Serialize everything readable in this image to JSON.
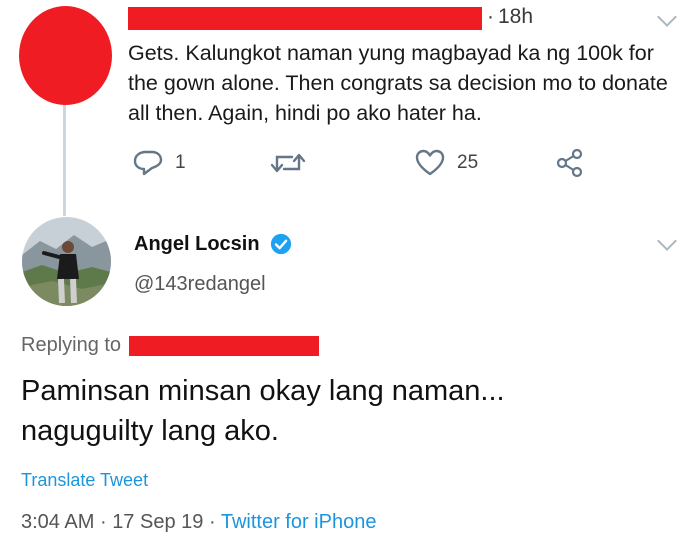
{
  "parent_tweet": {
    "time": "18h",
    "text": "Gets. Kalungkot naman yung magbayad ka ng 100k for the gown alone. Then congrats sa decision mo to donate all then. Again, hindi po ako hater ha.",
    "reply_count": "1",
    "retweet_count": "",
    "like_count": "25"
  },
  "tweet": {
    "author_name": "Angel Locsin",
    "handle": "@143redangel",
    "replying_to_label": "Replying to",
    "text_line1": "Paminsan minsan okay lang naman...",
    "text_line2": "naguguilty lang ako.",
    "translate_label": "Translate Tweet",
    "time": "3:04 AM",
    "date": "17 Sep 19",
    "separator": "·",
    "source": "Twitter for iPhone"
  },
  "icons": [
    "reply-icon",
    "retweet-icon",
    "like-icon",
    "share-icon",
    "verified-badge-icon",
    "chevron-down-icon"
  ],
  "colors": {
    "redaction": "#ef1c24",
    "link": "#1b95e0",
    "verified": "#1da1f2",
    "icon": "#657786"
  }
}
